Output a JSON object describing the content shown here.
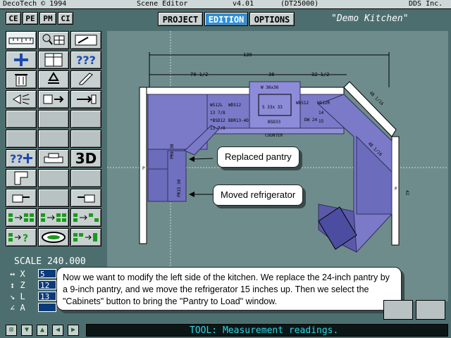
{
  "titlebar": {
    "left": "DecoTech © 1994",
    "center": "Scene Editor",
    "version": "v4.01",
    "code": "(DT25000)",
    "company": "DDS Inc."
  },
  "modebuttons": [
    "CE",
    "PE",
    "PM",
    "CI"
  ],
  "tabs": [
    {
      "label": "PROJECT",
      "active": false
    },
    {
      "label": "EDITION",
      "active": true
    },
    {
      "label": "OPTIONS",
      "active": false
    }
  ],
  "project_name": "\"Demo Kitchen\"",
  "tools": {
    "three_d": "3D",
    "help": "???"
  },
  "scale": {
    "label": "SCALE 240.000",
    "rows": [
      {
        "axis": "X",
        "value": "5"
      },
      {
        "axis": "Z",
        "value": "12"
      },
      {
        "axis": "L",
        "value": "13"
      },
      {
        "axis": "A",
        "value": ""
      }
    ]
  },
  "plan": {
    "dim_total": "139",
    "dim_left": "70 1/2",
    "dim_mid": "36",
    "dim_right": "32 1/2",
    "sink_top": "W 36x36",
    "sink_mid": "S 33x 33",
    "sink_bot": "BSD33",
    "ws12l": "WS12L",
    "wd12": "WDS12",
    "ws12r": "WS12R",
    "wd12r": "WDS12",
    "b1378": "13 7/8",
    "b1378b": "13 7/8",
    "bsd12": "*BSD12",
    "bdr": "BDR13-4D",
    "dw": "DW 24",
    "counter": "COUNTER",
    "pr930": "PR9 30",
    "pr1530": "PR15 30",
    "dim_side": "48 1/16",
    "dim_side2": "48 1/16",
    "n14": "14",
    "n15": "15",
    "p1": "P",
    "p2": "P",
    "n42": "42"
  },
  "callouts": {
    "replaced": "Replaced pantry",
    "moved": "Moved refrigerator"
  },
  "note": "Now we want to modify the left side of the kitchen. We replace the 24-inch pantry by a 9-inch pantry, and we move the refrigerator 15 inches up. Then we select the \"Cabinets\" button to bring the \"Pantry to Load\" window.",
  "status": "TOOL: Measurement readings."
}
